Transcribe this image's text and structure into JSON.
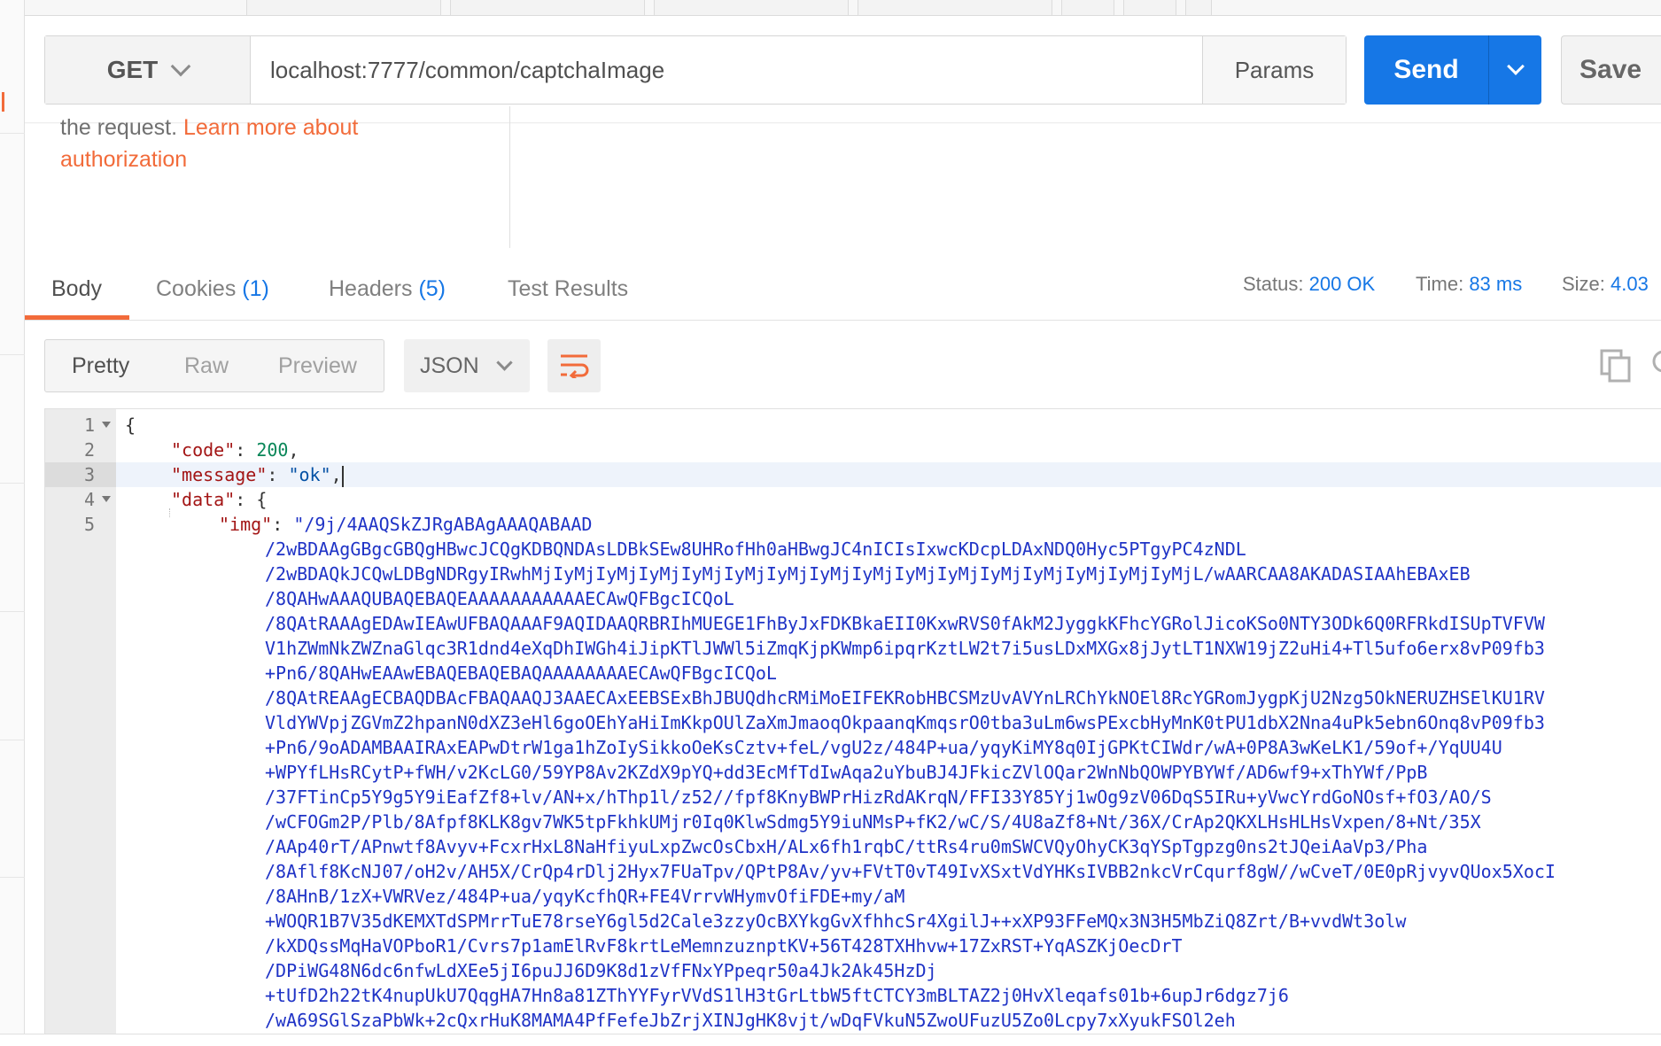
{
  "request": {
    "method": "GET",
    "url": "localhost:7777/common/captchaImage",
    "params_label": "Params",
    "send_label": "Send",
    "save_label": "Save"
  },
  "auth_help": {
    "text": "the request.",
    "link_text_1": "Learn more about",
    "link_text_2": "authorization"
  },
  "response_tabs": [
    {
      "label": "Body",
      "count": ""
    },
    {
      "label": "Cookies",
      "count": "(1)"
    },
    {
      "label": "Headers",
      "count": "(5)"
    },
    {
      "label": "Test Results",
      "count": ""
    }
  ],
  "status": {
    "status_label": "Status:",
    "status_value": "200 OK",
    "time_label": "Time:",
    "time_value": "83 ms",
    "size_label": "Size:",
    "size_value": "4.03"
  },
  "view_options": [
    "Pretty",
    "Raw",
    "Preview"
  ],
  "format_select": "JSON",
  "editor": {
    "line_numbers": [
      "1",
      "2",
      "3",
      "4",
      "5"
    ],
    "line1": "{",
    "code_key": "\"code\"",
    "code_value": "200",
    "message_key": "\"message\"",
    "message_value": "\"ok\"",
    "data_key": "\"data\"",
    "img_key": "\"img\"",
    "img_lines": [
      "\"/9j/4AAQSkZJRgABAgAAAQABAAD",
      "/2wBDAAgGBgcGBQgHBwcJCQgKDBQNDAsLDBkSEw8UHRofHh0aHBwgJC4nICIsIxwcKDcpLDAxNDQ0Hyc5PTgyPC4zNDL",
      "/2wBDAQkJCQwLDBgNDRgyIRwhMjIyMjIyMjIyMjIyMjIyMjIyMjIyMjIyMjIyMjIyMjIyMjIyMjIyMjIyMjIyMjL/wAARCAA8AKADASIAAhEBAxEB",
      "/8QAHwAAAQUBAQEBAQEAAAAAAAAAAAECAwQFBgcICQoL",
      "/8QAtRAAAgEDAwIEAwUFBAQAAAF9AQIDAAQRBRIhMUEGE1FhByJxFDKBkaEII0KxwRVS0fAkM2JyggkKFhcYGRolJicoKSo0NTY3ODk6Q0RFRkdISUpTVFVW",
      "V1hZWmNkZWZnaGlqc3R1dnd4eXqDhIWGh4iJipKTlJWWl5iZmqKjpKWmp6ipqrKztLW2t7i5usLDxMXGx8jJytLT1NXW19jZ2uHi4+Tl5ufo6erx8vP09fb3",
      "+Pn6/8QAHwEAAwEBAQEBAQEBAQAAAAAAAAECAwQFBgcICQoL",
      "/8QAtREAAgECBAQDBAcFBAQAAQJ3AAECAxEEBSExBhJBUQdhcRMiMoEIFEKRobHBCSMzUvAVYnLRChYkNOEl8RcYGRomJygpKjU2Nzg5OkNERUZHSElKU1RV",
      "VldYWVpjZGVmZ2hpanN0dXZ3eHl6goOEhYaHiImKkpOUlZaXmJmaoqOkpaanqKmqsrO0tba3uLm6wsPExcbHyMnK0tPU1dbX2Nna4uPk5ebn6Onq8vP09fb3",
      "+Pn6/9oADAMBAAIRAxEAPwDtrW1ga1hZoIySikkoOeKsCztv+feL/vgU2z/484P+ua/yqyKiMY8q0IjGPKtCIWdr/wA+0P8A3wKeLK1/59of+/YqUU4U",
      "+WPYfLHsRCytP+fWH/v2KcLG0/59YP8Av2KZdX9pYQ+dd3EcMfTdIwAqa2uYbuBJ4JFkicZVlOQar2WnNbQOWPYBYWf/AD6wf9+xThYWf/PpB",
      "/37FTinCp5Y9g5Y9iEafZf8+lv/AN+x/hThp1l/z52//fpf8KnyBWPrHizRdAKrqN/FFI33Y85Yj1wOg9zV06DqS5IRu+yVwcYrdGoNOsf+fO3/AO/S",
      "/wCFOGm2P/Plb/8Afpf8KLK8gv7WK5tpFkhkUMjr0Iq0KlwSdmg5Y9iuNMsP+fK2/wC/S/4U8aZf8+Nt/36X/CrAp2QKXLHsHLHsVxpen/8+Nt/35X",
      "/AAp40rT/APnwtf8Avyv+FcxrHxL8NaHfiyuLxpZwcOsCbxH/ALx6fh1rqbC/ttRs4ru0mSWCVQyOhyCK3qYSpTgpzg0ns2tJQeiAaVp3/Pha",
      "/8Aflf8KcNJ07/oH2v/AH5X/CrQp4rDlj2Hyx7FUaTpv/QPtP8Av/yv+FVtT0vT49IvXSxtVdYHKsIVBB2nkcVrCqurf8gW//wCveT/0E0pRjvyvQUox5XocI",
      "/8AHnB/1zX+VWRVez/484P+ua/yqyKcfhQR+FE4VrrvWHymvOfiFDE+my/aM",
      "+WOQR1B7V35dKEMXTdSPMrrTuE78rseY6gl5d2Cale3zzyOcBXYkgGvXfhhcSr4XgilJ++xXP93FFeMQx3N3H5MbZiQ8Zrt/B+vvdWt3olw",
      "/kXDQssMqHaVOPboR1/Cvrs7p1amElRvF8krtLeMemnzuznptKV+56T428TXHhvw+17ZxRST+YqASZKjOecDrT",
      "/DPiWG48N6dc6nfwLdXEe5jI6puJJ6D9K8d1zVfFNxYPpeqr50a4Jk2Ak45HzDj",
      "+tUfD2h22tK4nupUkU7QqgHA7Hn8a81ZThYYFyrVVdS1lH3tGrLtbW5ftCTCY3mBLTAZ2j0HvXleqafs01b+6upJr6dgz7j6",
      "/wA69SGlSzaPbWk+2cQxrHuK8MAMA4PfFefeJbZrjXINJgHK8vjt/wDqFVkuN5ZwoUFuzU5Zo0Lcpy7xXyukFSOl2eh"
    ]
  }
}
